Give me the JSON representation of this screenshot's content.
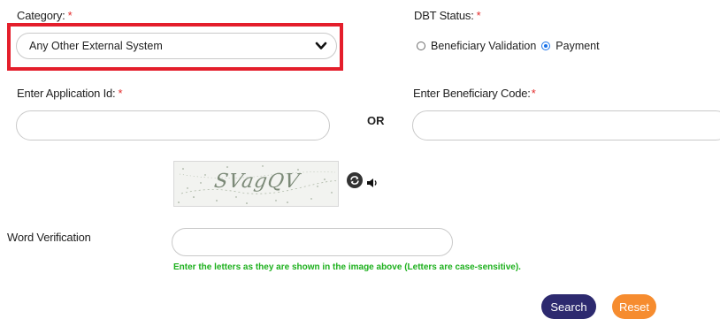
{
  "category": {
    "label": "Category:",
    "required_mark": "*",
    "selected": "Any Other External System"
  },
  "dbt_status": {
    "label": "DBT Status:",
    "required_mark": "*",
    "options": [
      {
        "label": "Beneficiary Validation",
        "checked": false
      },
      {
        "label": "Payment",
        "checked": true
      }
    ]
  },
  "application_id": {
    "label": "Enter Application Id:",
    "required_mark": "*",
    "value": ""
  },
  "or_text": "OR",
  "beneficiary_code": {
    "label": "Enter Beneficiary Code:",
    "required_mark": "*",
    "value": ""
  },
  "captcha": {
    "text": "SVagQV",
    "refresh_icon": "refresh-icon",
    "audio_icon": "speaker-icon"
  },
  "word_verification": {
    "label": "Word Verification",
    "value": "",
    "hint": "Enter the letters as they are shown in the image above (Letters are case-sensitive)."
  },
  "buttons": {
    "search": "Search",
    "reset": "Reset"
  },
  "colors": {
    "highlight": "#e41e2b",
    "required": "#e32b2b",
    "hint": "#1db01d",
    "search_bg": "#2d2a6f",
    "reset_bg": "#f68c2f"
  }
}
